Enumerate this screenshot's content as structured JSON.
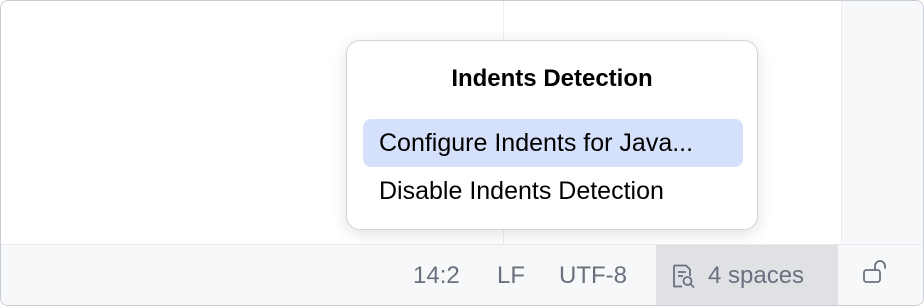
{
  "popup": {
    "title": "Indents Detection",
    "items": [
      {
        "label": "Configure Indents for Java...",
        "selected": true
      },
      {
        "label": "Disable Indents Detection",
        "selected": false
      }
    ]
  },
  "status_bar": {
    "caret_position": "14:2",
    "line_separator": "LF",
    "encoding": "UTF-8",
    "indent": "4 spaces",
    "indent_icon": "document-search-icon",
    "lock_icon": "unlock-icon"
  },
  "colors": {
    "selection": "#d5e0fa",
    "status_text": "#6c707e",
    "status_bar_bg": "#f7f8fa",
    "indent_widget_bg": "#dfe1e5"
  }
}
